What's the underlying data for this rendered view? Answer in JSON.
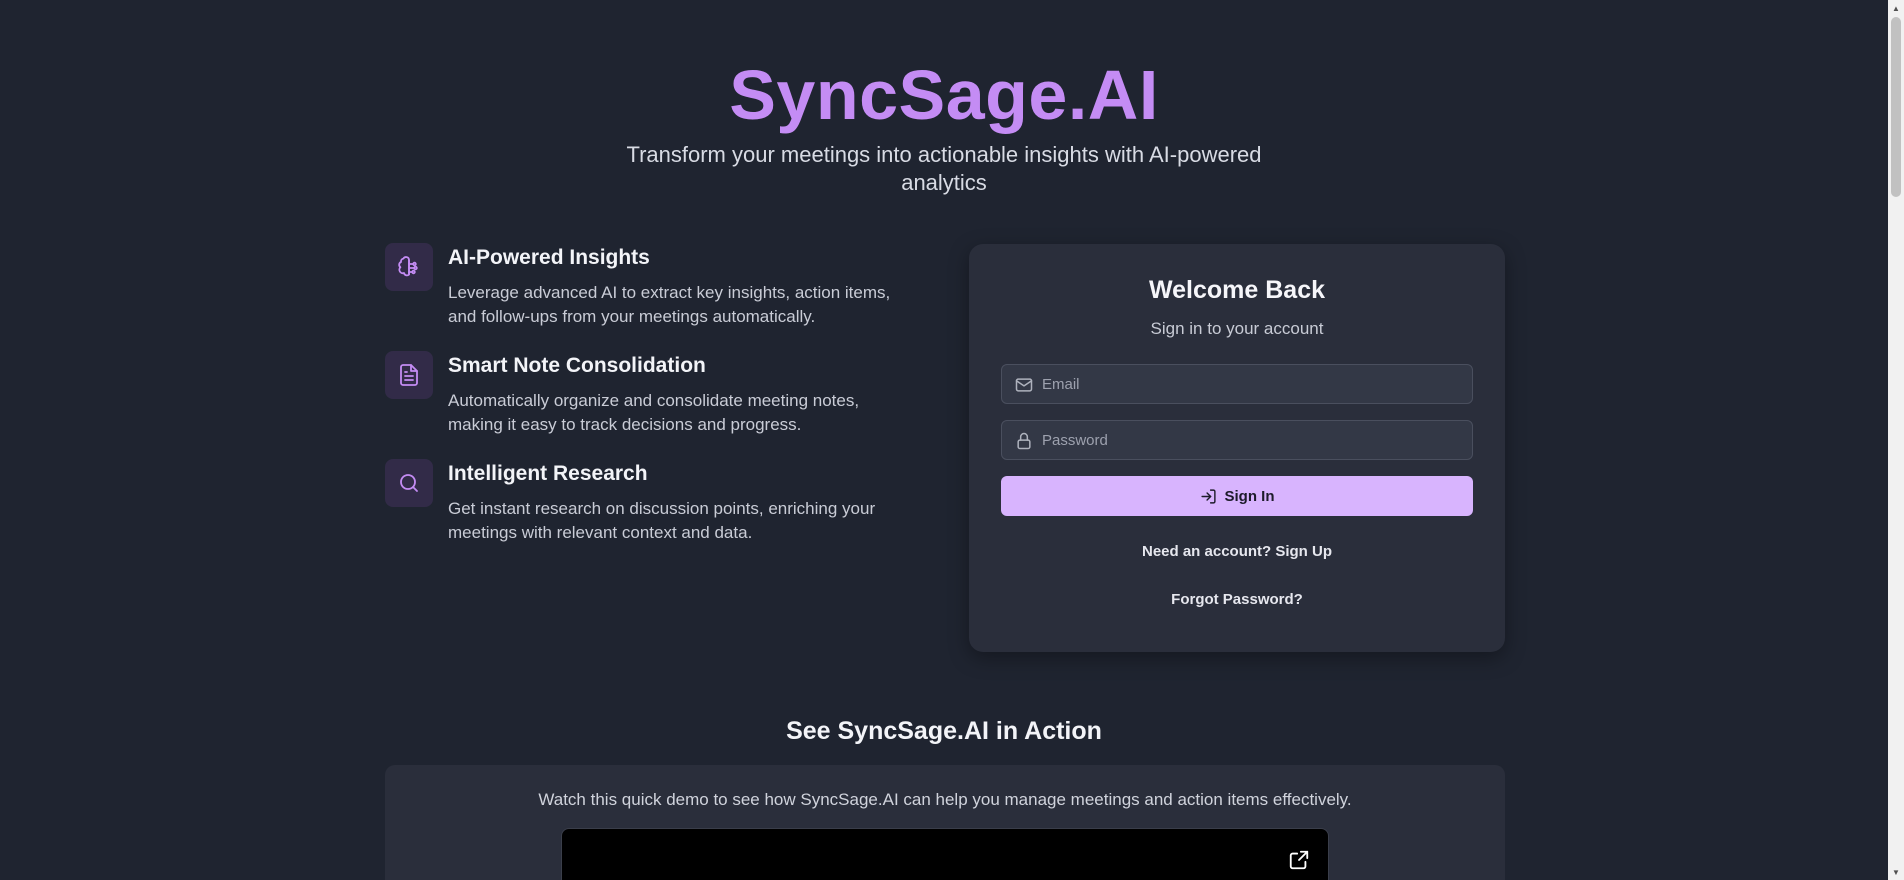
{
  "hero": {
    "title": "SyncSage.AI",
    "subtitle": "Transform your meetings into actionable insights with AI-powered analytics"
  },
  "features": [
    {
      "icon": "brain-circuit-icon",
      "title": "AI-Powered Insights",
      "description": "Leverage advanced AI to extract key insights, action items, and follow-ups from your meetings automatically."
    },
    {
      "icon": "document-icon",
      "title": "Smart Note Consolidation",
      "description": "Automatically organize and consolidate meeting notes, making it easy to track decisions and progress."
    },
    {
      "icon": "search-icon",
      "title": "Intelligent Research",
      "description": "Get instant research on discussion points, enriching your meetings with relevant context and data."
    }
  ],
  "login": {
    "title": "Welcome Back",
    "subtitle": "Sign in to your account",
    "email_placeholder": "Email",
    "email_value": "",
    "password_placeholder": "Password",
    "password_value": "",
    "signin_label": "Sign In",
    "signup_link": "Need an account? Sign Up",
    "forgot_link": "Forgot Password?"
  },
  "demo": {
    "heading": "See SyncSage.AI in Action",
    "caption": "Watch this quick demo to see how SyncSage.AI can help you manage meetings and action items effectively."
  },
  "colors": {
    "background": "#1f2430",
    "brand": "#c48cf4",
    "button": "#d8b4fe",
    "card": "#2a2e3b"
  }
}
